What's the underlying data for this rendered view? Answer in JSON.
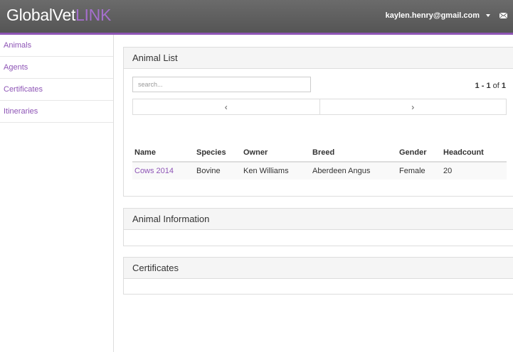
{
  "header": {
    "logo_main": "GlobalVet",
    "logo_accent": "LINK",
    "user_email": "kaylen.henry@gmail.com",
    "caret_icon": "chevron-down-icon",
    "mail_icon": "envelope-icon"
  },
  "colors": {
    "accent": "#8e55b6",
    "topbar": "#606060"
  },
  "sidebar": {
    "items": [
      {
        "label": "Animals"
      },
      {
        "label": "Agents"
      },
      {
        "label": "Certificates"
      },
      {
        "label": "Itineraries"
      }
    ]
  },
  "animal_list": {
    "title": "Animal List",
    "search_placeholder": "search...",
    "pager_range": "1 - 1",
    "pager_of": "of",
    "pager_total": "1",
    "prev_icon": "chevron-left-icon",
    "next_icon": "chevron-right-icon",
    "prev_glyph": "‹",
    "next_glyph": "›",
    "columns": [
      "Name",
      "Species",
      "Owner",
      "Breed",
      "Gender",
      "Headcount"
    ],
    "rows": [
      [
        "Cows 2014",
        "Bovine",
        "Ken Williams",
        "Aberdeen Angus",
        "Female",
        "20"
      ]
    ]
  },
  "animal_information": {
    "title": "Animal Information"
  },
  "certificates": {
    "title": "Certificates"
  }
}
